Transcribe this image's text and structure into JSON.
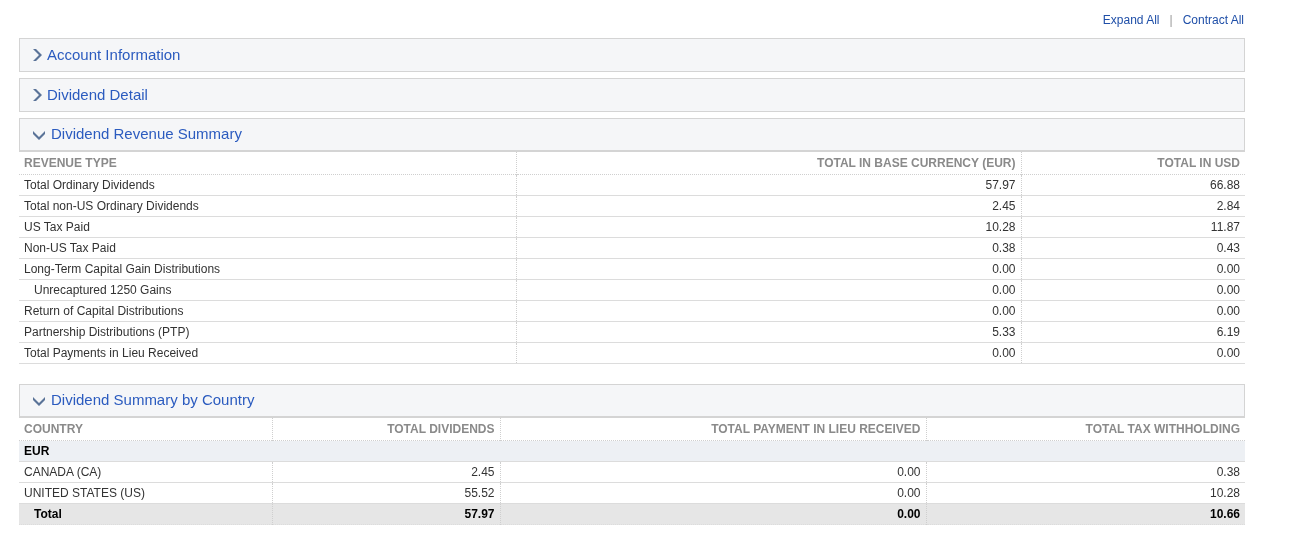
{
  "links": [
    "Expand All",
    "Contract All"
  ],
  "link_separator": "|",
  "sections": [
    {
      "title": "Account Information",
      "expanded": false
    },
    {
      "title": "Dividend Detail",
      "expanded": false
    },
    {
      "title": "Dividend Revenue Summary",
      "expanded": true,
      "table": {
        "kind": "revenue",
        "columns": [
          "REVENUE TYPE",
          "TOTAL IN BASE CURRENCY (EUR)",
          "TOTAL IN USD"
        ],
        "rows": [
          {
            "cells": [
              "Total Ordinary Dividends",
              "57.97",
              "66.88"
            ]
          },
          {
            "cells": [
              "Total non-US Ordinary Dividends",
              "2.45",
              "2.84"
            ]
          },
          {
            "cells": [
              "US Tax Paid",
              "10.28",
              "11.87"
            ]
          },
          {
            "cells": [
              "Non-US Tax Paid",
              "0.38",
              "0.43"
            ]
          },
          {
            "cells": [
              "Long-Term Capital Gain Distributions",
              "0.00",
              "0.00"
            ],
            "children": [
              {
                "cells": [
                  "Unrecaptured 1250 Gains",
                  "0.00",
                  "0.00"
                ]
              }
            ]
          },
          {
            "cells": [
              "Return of Capital Distributions",
              "0.00",
              "0.00"
            ]
          },
          {
            "cells": [
              "Partnership Distributions (PTP)",
              "5.33",
              "6.19"
            ]
          },
          {
            "cells": [
              "Total Payments in Lieu Received",
              "0.00",
              "0.00"
            ]
          }
        ]
      }
    },
    {
      "title": "Dividend Summary by Country",
      "expanded": true,
      "table": {
        "kind": "country",
        "columns": [
          "COUNTRY",
          "TOTAL DIVIDENDS",
          "TOTAL PAYMENT IN LIEU RECEIVED",
          "TOTAL TAX WITHHOLDING"
        ],
        "rows": [
          {
            "kind": "group",
            "cells": [
              "EUR"
            ]
          },
          {
            "kind": "data",
            "cells": [
              "CANADA (CA)",
              "2.45",
              "0.00",
              "0.38"
            ]
          },
          {
            "kind": "data",
            "cells": [
              "UNITED STATES (US)",
              "55.52",
              "0.00",
              "10.28"
            ]
          },
          {
            "kind": "total",
            "cells": [
              "Total",
              "57.97",
              "0.00",
              "10.66"
            ]
          }
        ]
      }
    }
  ]
}
